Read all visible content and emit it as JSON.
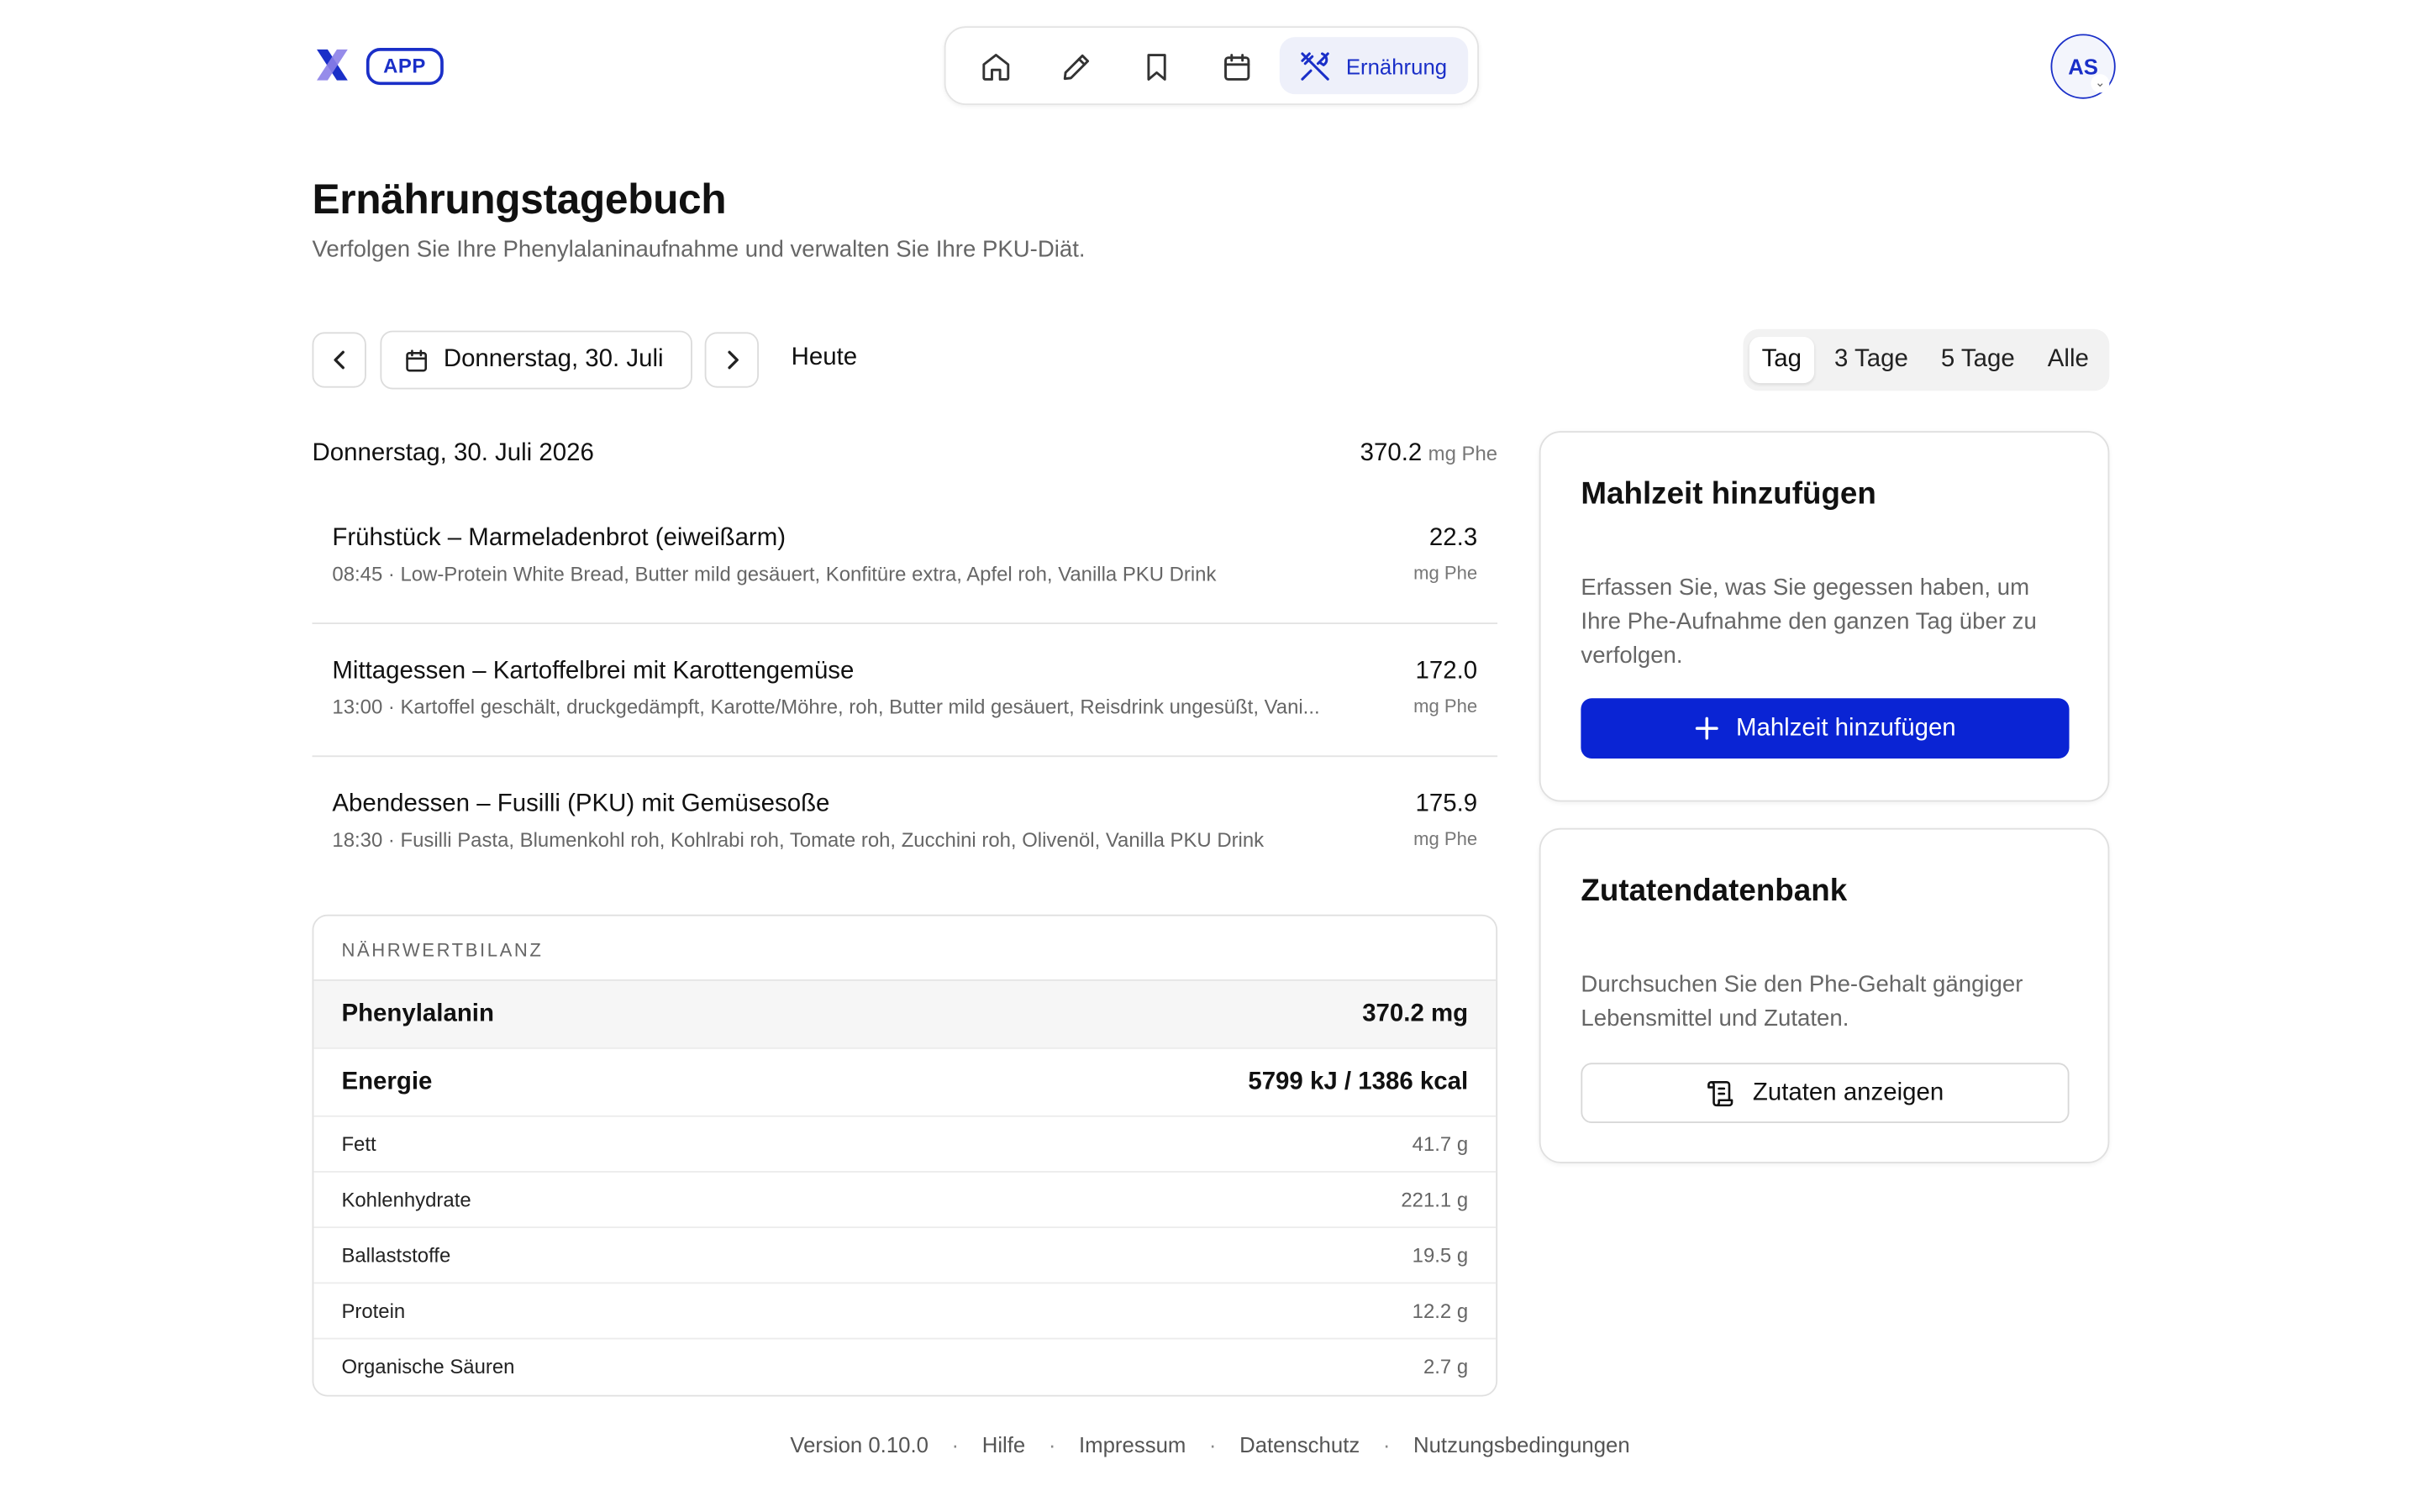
{
  "header": {
    "app_badge": "APP",
    "nav": {
      "active_label": "Ernährung"
    },
    "avatar_initials": "AS"
  },
  "page": {
    "title": "Ernährungstagebuch",
    "subtitle": "Verfolgen Sie Ihre Phenylalaninaufnahme und verwalten Sie Ihre PKU-Diät."
  },
  "date_nav": {
    "current_date": "Donnerstag, 30. Juli",
    "today_label": "Heute",
    "ranges": [
      "Tag",
      "3 Tage",
      "5 Tage",
      "Alle"
    ],
    "active_range": "Tag"
  },
  "day": {
    "label": "Donnerstag, 30. Juli 2026",
    "total": "370.2",
    "unit": "mg Phe"
  },
  "meals": [
    {
      "title": "Frühstück – Marmeladenbrot (eiweißarm)",
      "desc": "08:45 · Low-Protein White Bread, Butter mild gesäuert, Konfitüre extra, Apfel roh, Vanilla PKU Drink",
      "phe": "22.3",
      "unit": "mg Phe"
    },
    {
      "title": "Mittagessen – Kartoffelbrei mit Karottengemüse",
      "desc": "13:00 · Kartoffel geschält, druckgedämpft, Karotte/Möhre, roh, Butter mild gesäuert, Reisdrink ungesüßt, Vani...",
      "phe": "172.0",
      "unit": "mg Phe"
    },
    {
      "title": "Abendessen – Fusilli (PKU) mit Gemüsesoße",
      "desc": "18:30 · Fusilli Pasta, Blumenkohl roh, Kohlrabi roh, Tomate roh, Zucchini roh, Olivenöl, Vanilla PKU Drink",
      "phe": "175.9",
      "unit": "mg Phe"
    }
  ],
  "nutrition": {
    "header": "NÄHRWERTBILANZ",
    "rows": [
      {
        "label": "Phenylalanin",
        "value": "370.2 mg"
      },
      {
        "label": "Energie",
        "value": "5799 kJ / 1386 kcal"
      },
      {
        "label": "Fett",
        "value": "41.7 g"
      },
      {
        "label": "Kohlenhydrate",
        "value": "221.1 g"
      },
      {
        "label": "Ballaststoffe",
        "value": "19.5 g"
      },
      {
        "label": "Protein",
        "value": "12.2 g"
      },
      {
        "label": "Organische Säuren",
        "value": "2.7 g"
      }
    ]
  },
  "add_meal_card": {
    "title": "Mahlzeit hinzufügen",
    "text": "Erfassen Sie, was Sie gegessen haben, um Ihre Phe-Aufnahme den ganzen Tag über zu verfolgen.",
    "button": "Mahlzeit hinzufügen"
  },
  "ingredients_card": {
    "title": "Zutatendatenbank",
    "text": "Durchsuchen Sie den Phe-Gehalt gängiger Lebensmittel und Zutaten.",
    "button": "Zutaten anzeigen"
  },
  "footer": {
    "version": "Version 0.10.0",
    "links": [
      "Hilfe",
      "Impressum",
      "Datenschutz",
      "Nutzungsbedingungen"
    ]
  },
  "colors": {
    "accent": "#0a24d4",
    "brand": "#1a2fc8"
  }
}
